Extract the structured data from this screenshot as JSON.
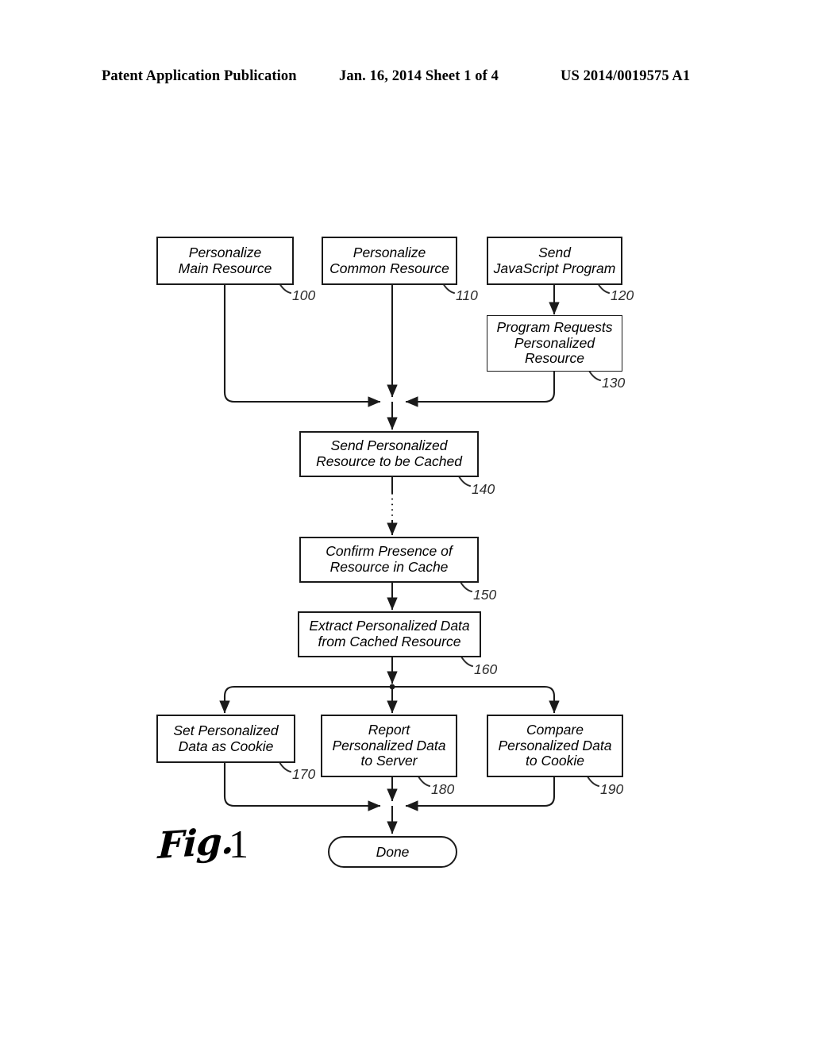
{
  "header": {
    "publication": "Patent Application Publication",
    "date_sheet": "Jan. 16, 2014  Sheet 1 of 4",
    "doc_number": "US 2014/0019575 A1"
  },
  "figure": {
    "caption_word": "Fig.",
    "caption_number": "1"
  },
  "flowchart": {
    "nodes": [
      {
        "id": "n100",
        "label": "Personalize\nMain Resource",
        "ref": "100"
      },
      {
        "id": "n110",
        "label": "Personalize\nCommon Resource",
        "ref": "110"
      },
      {
        "id": "n120",
        "label": "Send\nJavaScript Program",
        "ref": "120"
      },
      {
        "id": "n130",
        "label": "Program Requests\nPersonalized\nResource",
        "ref": "130"
      },
      {
        "id": "n140",
        "label": "Send Personalized\nResource to be Cached",
        "ref": "140"
      },
      {
        "id": "n150",
        "label": "Confirm Presence of\nResource in Cache",
        "ref": "150"
      },
      {
        "id": "n160",
        "label": "Extract Personalized Data\nfrom Cached Resource",
        "ref": "160"
      },
      {
        "id": "n170",
        "label": "Set Personalized\nData as Cookie",
        "ref": "170"
      },
      {
        "id": "n180",
        "label": "Report\nPersonalized Data\nto Server",
        "ref": "180"
      },
      {
        "id": "n190",
        "label": "Compare\nPersonalized Data\nto Cookie",
        "ref": "190"
      }
    ],
    "terminal": {
      "id": "done",
      "label": "Done"
    },
    "line_color": "#1a1a1a"
  }
}
